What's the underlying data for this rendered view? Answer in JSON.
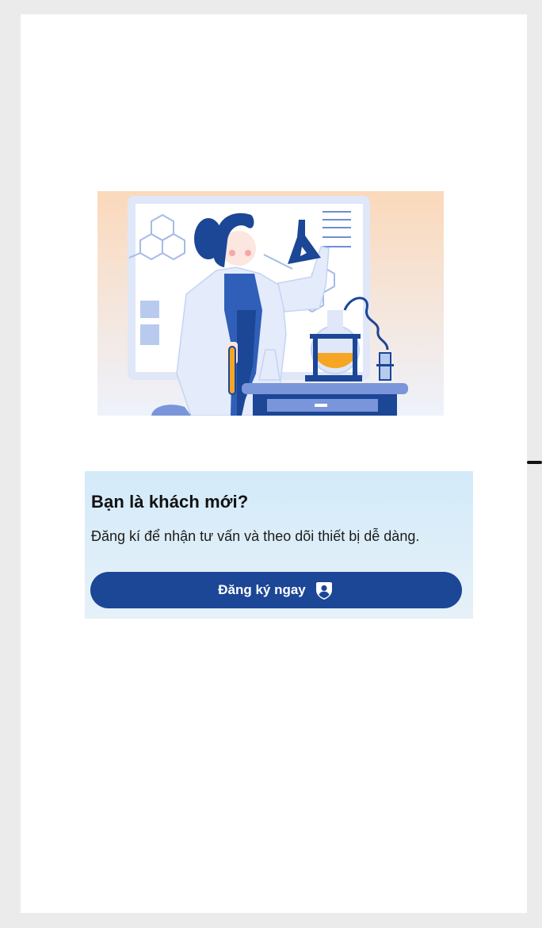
{
  "illustration": {
    "icon": "scientist-lab-illustration",
    "colors": {
      "bg_top": "#fbd9bb",
      "bg_bottom": "#eef2fb",
      "primary_blue": "#1c4696",
      "accent_orange": "#f6a623"
    }
  },
  "signup_card": {
    "title": "Bạn là khách mới?",
    "description": "Đăng kí để nhận tư vấn và theo dõi thiết bị dễ dàng.",
    "button_label": "Đăng ký ngay",
    "button_icon": "user-shield-icon",
    "button_color": "#1c4696",
    "card_color": "#d8ecf8"
  }
}
